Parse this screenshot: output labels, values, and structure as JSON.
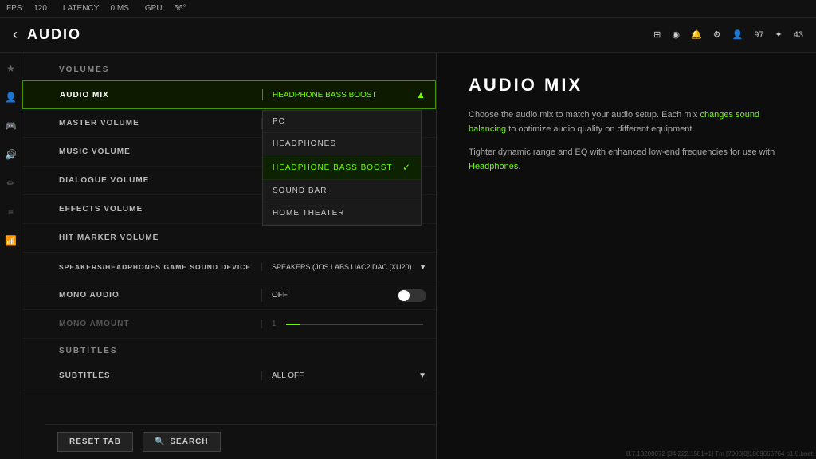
{
  "topbar": {
    "fps_label": "FPS:",
    "fps_value": "120",
    "latency_label": "LATENCY:",
    "latency_value": "0 MS",
    "gpu_label": "GPU:",
    "gpu_value": "56°"
  },
  "header": {
    "back_icon": "‹",
    "title": "AUDIO",
    "icons": {
      "grid": "⊞",
      "headset": "🎧",
      "bell": "🔔",
      "gear": "⚙",
      "level": "97",
      "players": "43"
    }
  },
  "sections": {
    "volumes_label": "VOLUMES",
    "subtitles_label": "SUBTITLES"
  },
  "settings": [
    {
      "id": "audio-mix",
      "label": "AUDIO MIX",
      "value": "HEADPHONE BASS BOOST",
      "active": true,
      "dropdown_open": true
    },
    {
      "id": "master-volume",
      "label": "MASTER VOLUME",
      "value": "",
      "has_star": true
    },
    {
      "id": "music-volume",
      "label": "MUSIC VOLUME",
      "value": ""
    },
    {
      "id": "dialogue-volume",
      "label": "DIALOGUE VOLUME",
      "value": ""
    },
    {
      "id": "effects-volume",
      "label": "EFFECTS VOLUME",
      "value": ""
    },
    {
      "id": "hit-marker-volume",
      "label": "HIT MARKER VOLUME",
      "value": ""
    },
    {
      "id": "sound-device",
      "label": "SPEAKERS/HEADPHONES GAME SOUND DEVICE",
      "value": "SPEAKERS (JOS LABS UAC2 DAC [XU20)"
    },
    {
      "id": "mono-audio",
      "label": "MONO AUDIO",
      "value": "OFF",
      "has_toggle": true
    },
    {
      "id": "mono-amount",
      "label": "MONO AMOUNT",
      "value": "1",
      "has_slider": true,
      "dimmed": true
    }
  ],
  "subtitles": [
    {
      "id": "subtitles",
      "label": "SUBTITLES",
      "value": "ALL OFF",
      "has_chevron": true
    }
  ],
  "dropdown_options": [
    {
      "id": "pc",
      "label": "PC",
      "selected": false
    },
    {
      "id": "headphones",
      "label": "HEADPHONES",
      "selected": false
    },
    {
      "id": "headphone-bass-boost",
      "label": "HEADPHONE BASS BOOST",
      "selected": true
    },
    {
      "id": "sound-bar",
      "label": "SOUND BAR",
      "selected": false
    },
    {
      "id": "home-theater",
      "label": "HOME THEATER",
      "selected": false
    }
  ],
  "buttons": {
    "reset": "RESET TAB",
    "search": "SEARCH"
  },
  "info_panel": {
    "title": "AUDIO MIX",
    "desc1_before": "Choose the audio mix to match your audio setup. Each mix ",
    "desc1_link": "changes sound balancing",
    "desc1_after": " to optimize audio quality on different equipment.",
    "desc2_before": "Tighter dynamic range and EQ with enhanced low-end frequencies for use with ",
    "desc2_link": "Headphones",
    "desc2_after": "."
  },
  "version": "8.7.13200072 [34.222.1581+1] Tm [7000[0]1869665764 p1.0.bnet"
}
